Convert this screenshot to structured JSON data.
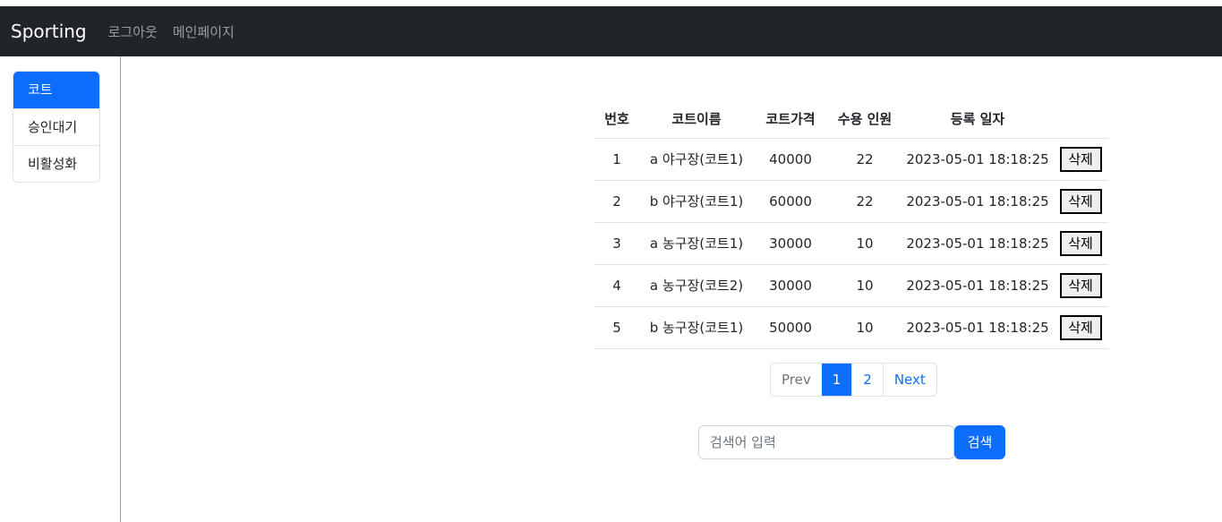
{
  "navbar": {
    "brand": "Sporting",
    "links": [
      "로그아웃",
      "메인페이지"
    ]
  },
  "sidebar": {
    "items": [
      {
        "label": "코트",
        "active": true
      },
      {
        "label": "승인대기",
        "active": false
      },
      {
        "label": "비활성화",
        "active": false
      }
    ]
  },
  "table": {
    "headers": [
      "번호",
      "코트이름",
      "코트가격",
      "수용 인원",
      "등록 일자",
      ""
    ],
    "rows": [
      {
        "no": "1",
        "name": "a 야구장(코트1)",
        "price": "40000",
        "capacity": "22",
        "date": "2023-05-01 18:18:25",
        "action": "삭제"
      },
      {
        "no": "2",
        "name": "b 야구장(코트1)",
        "price": "60000",
        "capacity": "22",
        "date": "2023-05-01 18:18:25",
        "action": "삭제"
      },
      {
        "no": "3",
        "name": "a 농구장(코트1)",
        "price": "30000",
        "capacity": "10",
        "date": "2023-05-01 18:18:25",
        "action": "삭제"
      },
      {
        "no": "4",
        "name": "a 농구장(코트2)",
        "price": "30000",
        "capacity": "10",
        "date": "2023-05-01 18:18:25",
        "action": "삭제"
      },
      {
        "no": "5",
        "name": "b 농구장(코트1)",
        "price": "50000",
        "capacity": "10",
        "date": "2023-05-01 18:18:25",
        "action": "삭제"
      }
    ]
  },
  "pagination": {
    "prev": "Prev",
    "pages": [
      "1",
      "2"
    ],
    "active_page": "1",
    "next": "Next"
  },
  "search": {
    "placeholder": "검색어 입력",
    "value": "",
    "button": "검색"
  },
  "colors": {
    "navbar_bg": "#212529",
    "primary": "#0d6efd"
  }
}
